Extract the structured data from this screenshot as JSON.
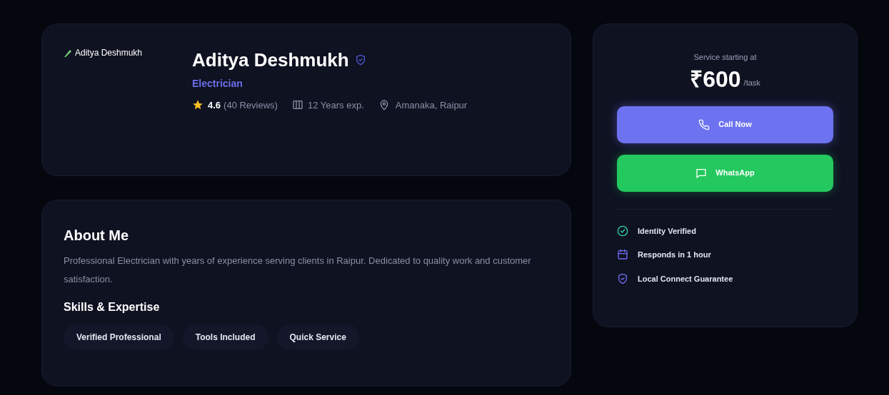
{
  "profile": {
    "image_alt": "Aditya Deshmukh",
    "name": "Aditya Deshmukh",
    "verified": true,
    "profession": "Electrician",
    "rating": "4.6",
    "reviews": "(40 Reviews)",
    "experience": "12 Years exp.",
    "location": "Amanaka, Raipur"
  },
  "about": {
    "title": "About Me",
    "text": "Professional Electrician with years of experience serving clients in Raipur. Dedicated to quality work and customer satisfaction.",
    "skills_title": "Skills & Expertise",
    "skills": [
      "Verified Professional",
      "Tools Included",
      "Quick Service"
    ]
  },
  "pricing": {
    "caption": "Service starting at",
    "price": "₹600",
    "unit": "/task",
    "buttons": [
      {
        "kind": "call",
        "label": "Call Now"
      },
      {
        "kind": "whatsapp",
        "label": "WhatsApp"
      }
    ],
    "features": [
      {
        "kind": "check",
        "label": "Identity Verified"
      },
      {
        "kind": "calendar",
        "label": "Responds in 1 hour"
      },
      {
        "kind": "shield",
        "label": "Local Connect Guarantee"
      }
    ]
  }
}
